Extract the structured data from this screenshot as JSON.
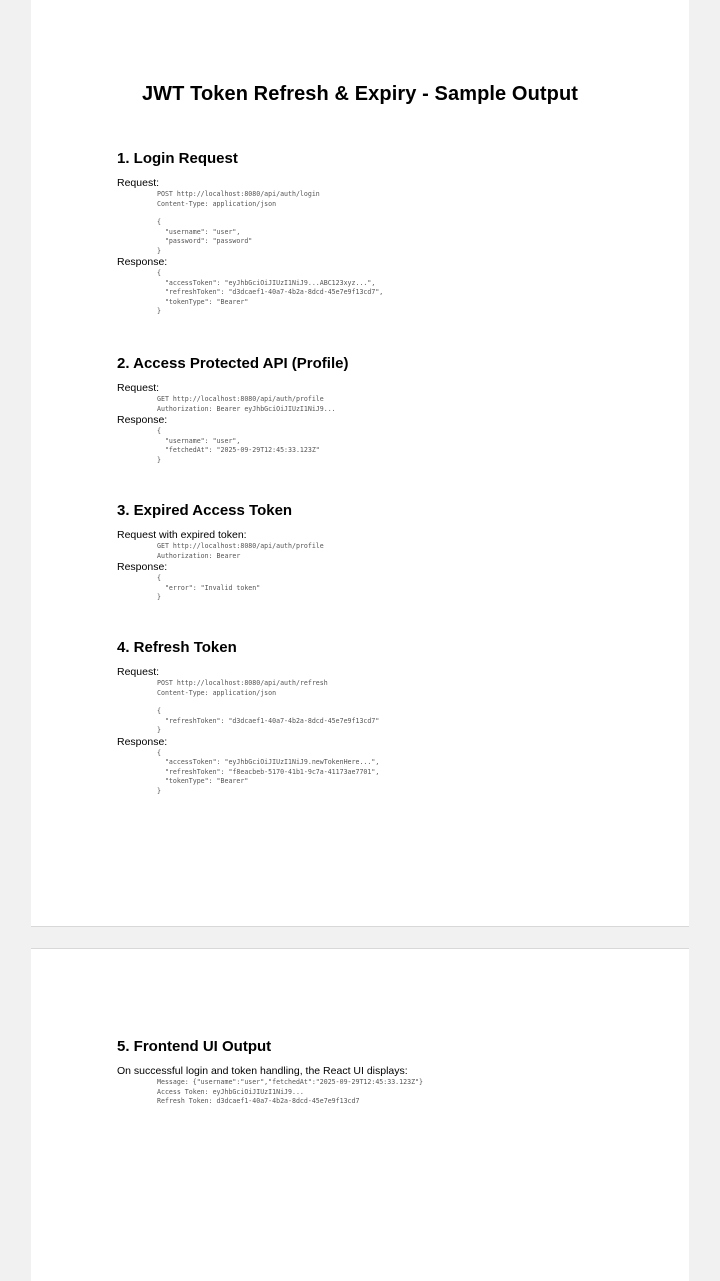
{
  "document": {
    "title": "JWT Token Refresh & Expiry - Sample Output"
  },
  "sections": [
    {
      "heading": "1. Login Request",
      "request_label": "Request:",
      "request_code": "POST http://localhost:8080/api/auth/login\nContent-Type: application/json",
      "request_body": "{\n  \"username\": \"user\",\n  \"password\": \"password\"\n}",
      "response_label": "Response:",
      "response_body": "{\n  \"accessToken\": \"eyJhbGciOiJIUzI1NiJ9...ABC123xyz...\",\n  \"refreshToken\": \"d3dcaef1-40a7-4b2a-8dcd-45e7e9f13cd7\",\n  \"tokenType\": \"Bearer\"\n}"
    },
    {
      "heading": "2. Access Protected API (Profile)",
      "request_label": "Request:",
      "request_code": "GET http://localhost:8080/api/auth/profile\nAuthorization: Bearer eyJhbGciOiJIUzI1NiJ9...",
      "response_label": "Response:",
      "response_body": "{\n  \"username\": \"user\",\n  \"fetchedAt\": \"2025-09-29T12:45:33.123Z\"\n}"
    },
    {
      "heading": "3. Expired Access Token",
      "request_label": "Request with expired token:",
      "request_code": "GET http://localhost:8080/api/auth/profile\nAuthorization: Bearer",
      "response_label": "Response:",
      "response_body": "{\n  \"error\": \"Invalid token\"\n}"
    },
    {
      "heading": "4. Refresh Token",
      "request_label": "Request:",
      "request_code": "POST http://localhost:8080/api/auth/refresh\nContent-Type: application/json",
      "request_body": "{\n  \"refreshToken\": \"d3dcaef1-40a7-4b2a-8dcd-45e7e9f13cd7\"\n}",
      "response_label": "Response:",
      "response_body": "{\n  \"accessToken\": \"eyJhbGciOiJIUzI1NiJ9.newTokenHere...\",\n  \"refreshToken\": \"f8eacbeb-5170-41b1-9c7a-41173ae7701\",\n  \"tokenType\": \"Bearer\"\n}"
    },
    {
      "heading": "5. Frontend UI Output",
      "intro": "On successful login and token handling, the React UI displays:",
      "code": "Message: {\"username\":\"user\",\"fetchedAt\":\"2025-09-29T12:45:33.123Z\"}\nAccess Token: eyJhbGciOiJIUzI1NiJ9...\nRefresh Token: d3dcaef1-40a7-4b2a-8dcd-45e7e9f13cd7"
    }
  ]
}
